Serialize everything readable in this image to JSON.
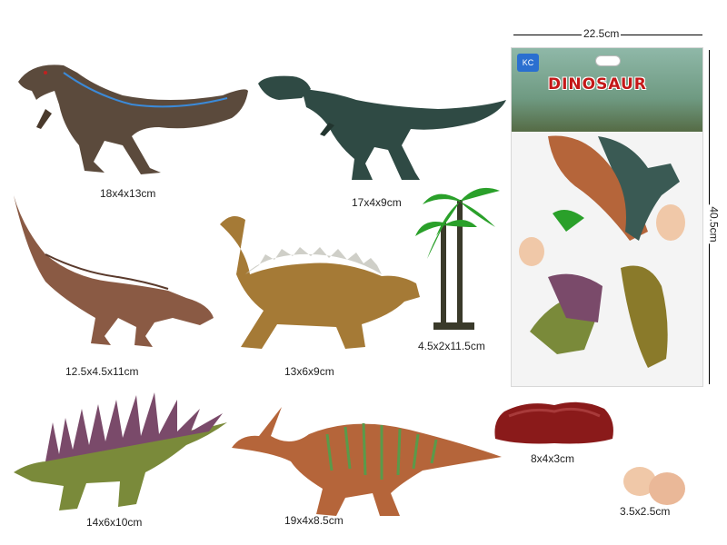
{
  "items": [
    {
      "name": "velociraptor",
      "size": "18x4x13cm"
    },
    {
      "name": "t-rex",
      "size": "17x4x9cm"
    },
    {
      "name": "carnotaurus",
      "size": "12.5x4.5x11cm"
    },
    {
      "name": "ankylosaurus",
      "size": "13x6x9cm"
    },
    {
      "name": "palm-tree",
      "size": "4.5x2x11.5cm"
    },
    {
      "name": "kentrosaurus",
      "size": "14x6x10cm"
    },
    {
      "name": "parasaurolophus",
      "size": "19x4x8.5cm"
    },
    {
      "name": "rock",
      "size": "8x4x3cm"
    },
    {
      "name": "eggs",
      "size": "3.5x2.5cm"
    }
  ],
  "package": {
    "title": "DINOSAUR",
    "logo": "KC",
    "width": "22.5cm",
    "height": "40.5cm"
  },
  "colors": {
    "velociraptor": "#5b4a3c",
    "velociraptor_stripe": "#3b8ad8",
    "trex": "#2f4a44",
    "carnotaurus": "#8a5a44",
    "ankylosaurus": "#a57a36",
    "ankylosaurus_spikes": "#cfcfc8",
    "kentrosaurus": "#7a8a3a",
    "kentrosaurus_spikes": "#7a4a6a",
    "parasaurolophus": "#b5653a",
    "parasaurolophus_stripes": "#5a9a4a",
    "palm_leaf": "#2aa02a",
    "palm_trunk": "#3a3a2a",
    "rock": "#8a1a1a",
    "egg": "#f0c8a8",
    "title_red": "#c41818"
  }
}
